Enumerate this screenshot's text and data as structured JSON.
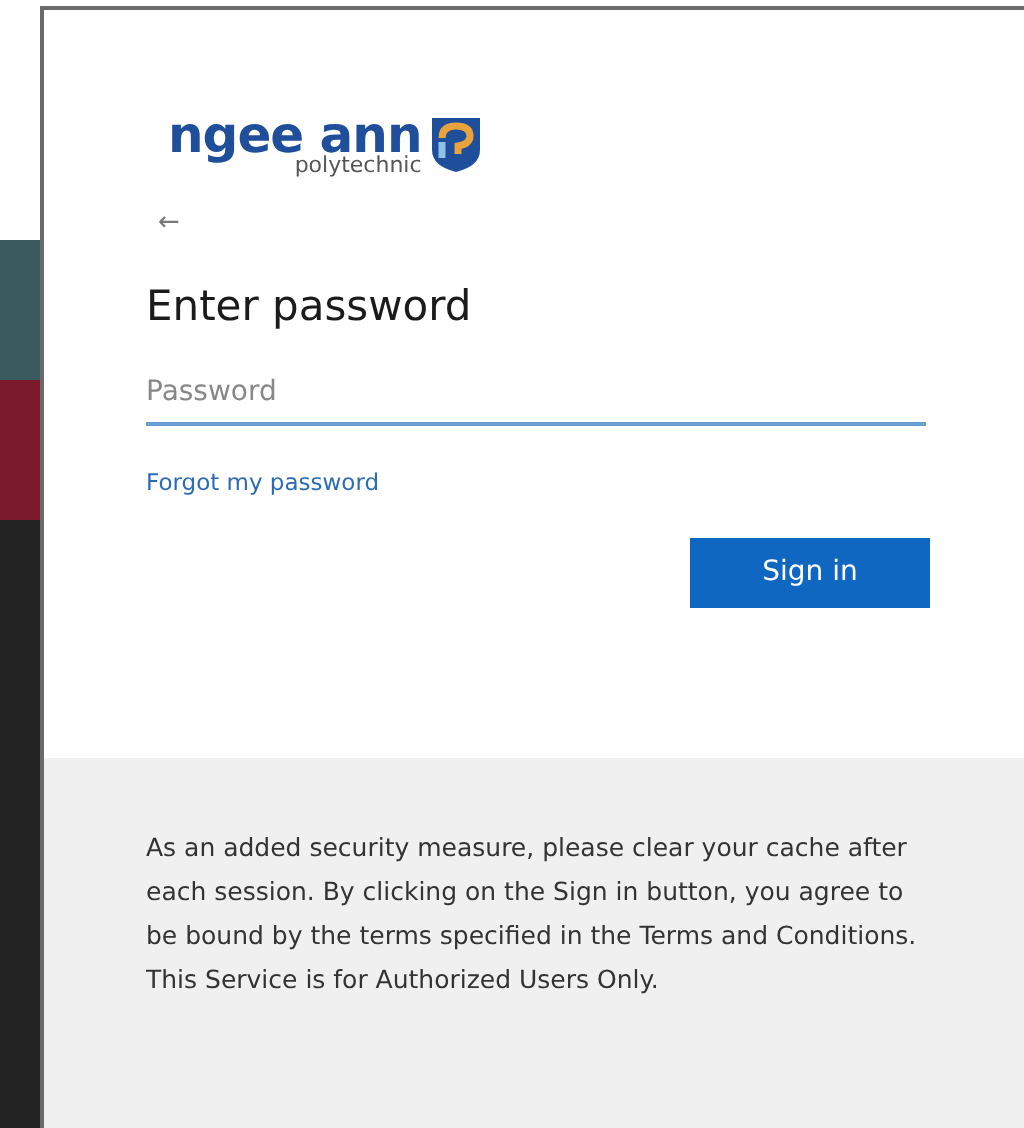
{
  "logo": {
    "name": "ngee ann",
    "subtitle": "polytechnic"
  },
  "back": "←",
  "heading": "Enter password",
  "password": {
    "placeholder": "Password"
  },
  "forgot_link": "Forgot my password",
  "sign_in_button": "Sign in",
  "notice": "As an added security measure, please clear your cache after each session. By clicking on the Sign in button, you agree to be bound by the terms specified in the Terms and Conditions. This Service is for Authorized Users Only."
}
